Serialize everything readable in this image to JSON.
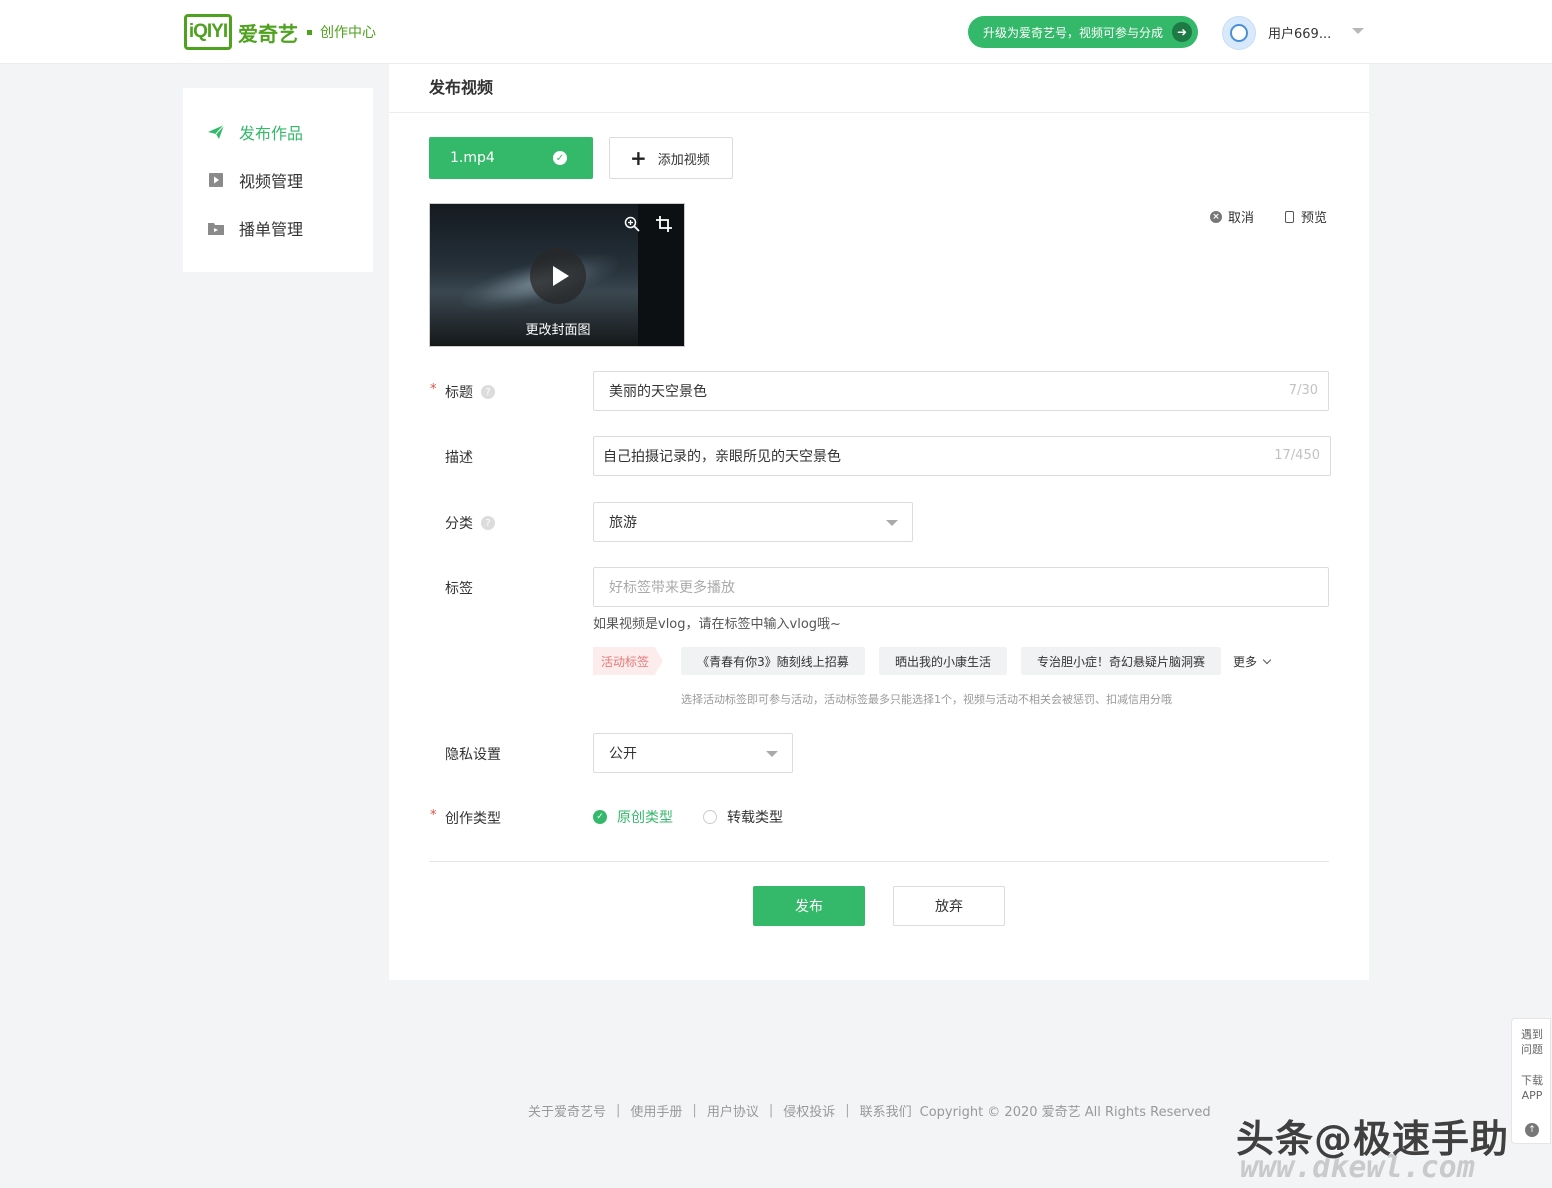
{
  "header": {
    "logo_mark": "iQIYI",
    "brand_name": "爱奇艺",
    "brand_sub": "创作中心",
    "upgrade_label": "升级为爱奇艺号，视频可参与分成",
    "username": "用户669..."
  },
  "sidebar": {
    "items": [
      {
        "label": "发布作品",
        "icon": "paper-plane-icon",
        "active": true
      },
      {
        "label": "视频管理",
        "icon": "video-play-icon",
        "active": false
      },
      {
        "label": "播单管理",
        "icon": "folder-icon",
        "active": false
      }
    ]
  },
  "main": {
    "title": "发布视频",
    "file_name": "1.mp4",
    "add_video_label": "添加视频",
    "change_cover_label": "更改封面图",
    "cancel_label": "取消",
    "preview_label": "预览"
  },
  "form": {
    "title_label": "标题",
    "title_value": "美丽的天空景色",
    "title_count": "7/30",
    "desc_label": "描述",
    "desc_value": "自己拍摄记录的，亲眼所见的天空景色",
    "desc_count": "17/450",
    "category_label": "分类",
    "category_value": "旅游",
    "tags_label": "标签",
    "tags_placeholder": "好标签带来更多播放",
    "tags_hint": "如果视频是vlog，请在标签中输入vlog哦~",
    "activity_tag_label": "活动标签",
    "activity_tags": [
      "《青春有你3》随刻线上招募",
      "晒出我的小康生活",
      "专治胆小症！奇幻悬疑片脑洞赛"
    ],
    "more_label": "更多",
    "activity_note": "选择活动标签即可参与活动，活动标签最多只能选择1个，视频与活动不相关会被惩罚、扣减信用分哦",
    "privacy_label": "隐私设置",
    "privacy_value": "公开",
    "creation_type_label": "创作类型",
    "creation_options": [
      "原创类型",
      "转载类型"
    ],
    "creation_selected": "原创类型",
    "publish_label": "发布",
    "discard_label": "放弃"
  },
  "footer": {
    "links": [
      "关于爱奇艺号",
      "使用手册",
      "用户协议",
      "侵权投诉",
      "联系我们"
    ],
    "separator": "|",
    "copyright": "Copyright © 2020 爱奇艺 All Rights Reserved"
  },
  "float_panel": {
    "feedback_label": "遇到问题",
    "download_label": "下载APP"
  },
  "watermark": {
    "main": "头条@极速手助",
    "sub": "www.dkewl.com"
  },
  "colors": {
    "accent": "#34b96a",
    "logo_green": "#4ea21e",
    "required": "#e54d42"
  }
}
